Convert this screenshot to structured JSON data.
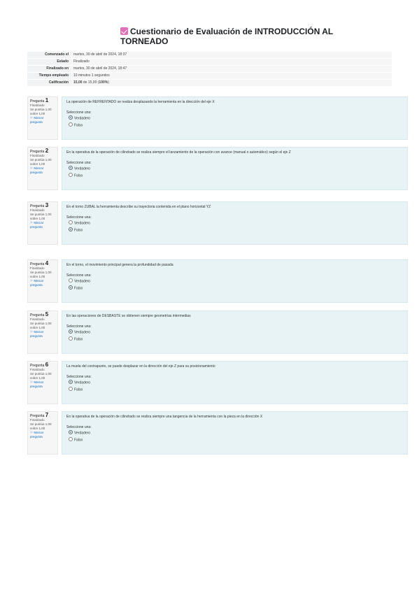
{
  "title": "Cuestionario de Evaluación de INTRODUCCIÓN AL TORNEADO",
  "icon": "quiz-icon",
  "summary": [
    {
      "label": "Comenzado el",
      "value": "martes, 30 de abril de 2024, 18:37"
    },
    {
      "label": "Estado",
      "value": "Finalizado"
    },
    {
      "label": "Finalizado en",
      "value": "martes, 30 de abril de 2024, 18:47"
    },
    {
      "label": "Tiempo empleado",
      "value": "10 minutos 1 segundos"
    },
    {
      "label": "Calificación",
      "value_bold": "15,00",
      "value_rest": " de 15,00 (",
      "value_pct": "100%",
      "value_end": ")"
    }
  ],
  "questions": [
    {
      "word": "Pregunta",
      "num": "1",
      "status": "Finalizado",
      "score": "Se puntúa 1,00 sobre 1,00",
      "flag": "Marcar pregunta",
      "text": "La operación de REFRENTADO se realiza desplazando la herramienta en la dirección del eje X",
      "prompt": "Seleccione una:",
      "opt1": "Verdadero",
      "opt2": "Falso",
      "selected": 1
    },
    {
      "word": "Pregunta",
      "num": "2",
      "status": "Finalizado",
      "score": "Se puntúa 1,00 sobre 1,00",
      "flag": "Marcar pregunta",
      "text": "En la operativa de la operación de cilindrado se realiza siempre el lanzamiento de la operación con avance (manual o automático) según el eje Z",
      "prompt": "Seleccione una:",
      "opt1": "Verdadero",
      "opt2": "Falso",
      "selected": 1
    },
    {
      "word": "Pregunta",
      "num": "3",
      "status": "Finalizado",
      "score": "Se puntúa 1,00 sobre 1,00",
      "flag": "Marcar pregunta",
      "text": "En el torno ZUBAL la herramienta describe su trayectoria contenida en el plano horizontal YZ",
      "prompt": "Seleccione una:",
      "opt1": "Verdadero",
      "opt2": "Falso",
      "selected": 2
    },
    {
      "word": "Pregunta",
      "num": "4",
      "status": "Finalizado",
      "score": "Se puntúa 1,00 sobre 1,00",
      "flag": "Marcar pregunta",
      "text": "En el torno, el movimiento principal genera la profundidad de pasada",
      "prompt": "Seleccione una:",
      "opt1": "Verdadero",
      "opt2": "Falso",
      "selected": 2
    },
    {
      "word": "Pregunta",
      "num": "5",
      "status": "Finalizado",
      "score": "Se puntúa 1,00 sobre 1,00",
      "flag": "Marcar pregunta",
      "text": "En las operaciones de DESBASTE se obtienen siempre geometrías intermedias",
      "prompt": "Seleccione una:",
      "opt1": "Verdadero",
      "opt2": "Falso",
      "selected": 1
    },
    {
      "word": "Pregunta",
      "num": "6",
      "status": "Finalizado",
      "score": "Se puntúa 1,00 sobre 1,00",
      "flag": "Marcar pregunta",
      "text": "La muela del contrapunto, se puede desplazar en la dirección del eje Z para su posicionamiento",
      "prompt": "Seleccione una:",
      "opt1": "Verdadero",
      "opt2": "Falso",
      "selected": 1
    },
    {
      "word": "Pregunta",
      "num": "7",
      "status": "Finalizado",
      "score": "Se puntúa 1,00 sobre 1,00",
      "flag": "Marcar pregunta",
      "text": "En la operativa de la operación de cilindrado se realiza siempre una tangencia de la herramienta con la pieza en la dirección X",
      "prompt": "Seleccione una:",
      "opt1": "Verdadero",
      "opt2": "Falso",
      "selected": 1
    }
  ]
}
